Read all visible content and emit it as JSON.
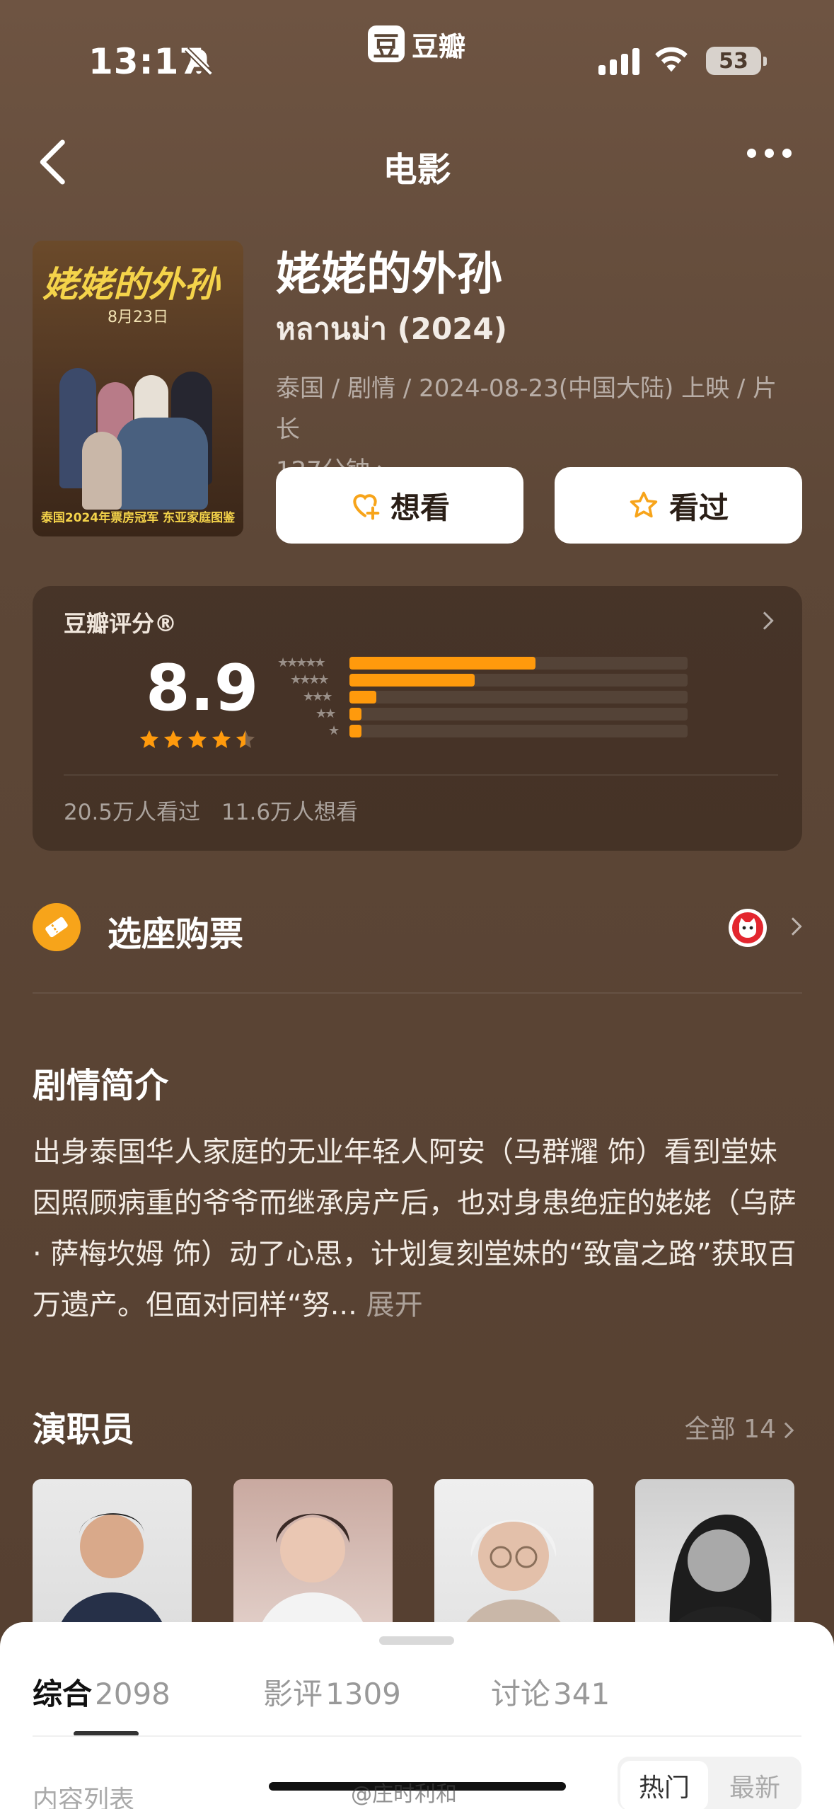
{
  "status_bar": {
    "time": "13:17",
    "app_name": "豆瓣",
    "app_logo_char": "豆",
    "battery": "53"
  },
  "nav": {
    "title": "电影"
  },
  "movie": {
    "title": "姥姥的外孙",
    "original_title": "หลานม่า (2024)",
    "meta_line": "泰国 / 剧情 / 2024-08-23(中国大陆) 上映 / 片长",
    "duration": "127分钟",
    "poster": {
      "title": "姥姥的外孙",
      "date": "8月23日",
      "tagline": "泰国2024年票房冠军 东亚家庭图鉴"
    }
  },
  "actions": {
    "want": "想看",
    "seen": "看过"
  },
  "rating": {
    "label": "豆瓣评分®",
    "score": "8.9",
    "stars_value": 4.5,
    "distribution": [
      {
        "stars": "★★★★★",
        "fraction": 0.55
      },
      {
        "stars": "★★★★",
        "fraction": 0.37
      },
      {
        "stars": "★★★",
        "fraction": 0.08
      },
      {
        "stars": "★★",
        "fraction": 0.035
      },
      {
        "stars": "★",
        "fraction": 0.035
      }
    ],
    "seen_count": "20.5万人看过",
    "want_count": "11.6万人想看"
  },
  "tickets": {
    "label": "选座购票"
  },
  "synopsis": {
    "title": "剧情简介",
    "text": "出身泰国华人家庭的无业年轻人阿安（马群耀 饰）看到堂妹因照顾病重的爷爷而继承房产后，也对身患绝症的姥姥（乌萨 · 萨梅坎姆 饰）动了心思，计划复刻堂妹的“致富之路”获取百万遗产。但面对同样“努...",
    "expand": "展开"
  },
  "cast": {
    "title": "演职员",
    "all_label": "全部 14"
  },
  "sheet": {
    "tabs": [
      {
        "label": "综合",
        "count": "2098"
      },
      {
        "label": "影评",
        "count": "1309"
      },
      {
        "label": "讨论",
        "count": "341"
      }
    ],
    "list_label": "内容列表",
    "sort_hot": "热门",
    "sort_new": "最新"
  },
  "watermark": "@庄时利和",
  "colors": {
    "accent": "#ff9a0c",
    "background": "#5a4535"
  }
}
